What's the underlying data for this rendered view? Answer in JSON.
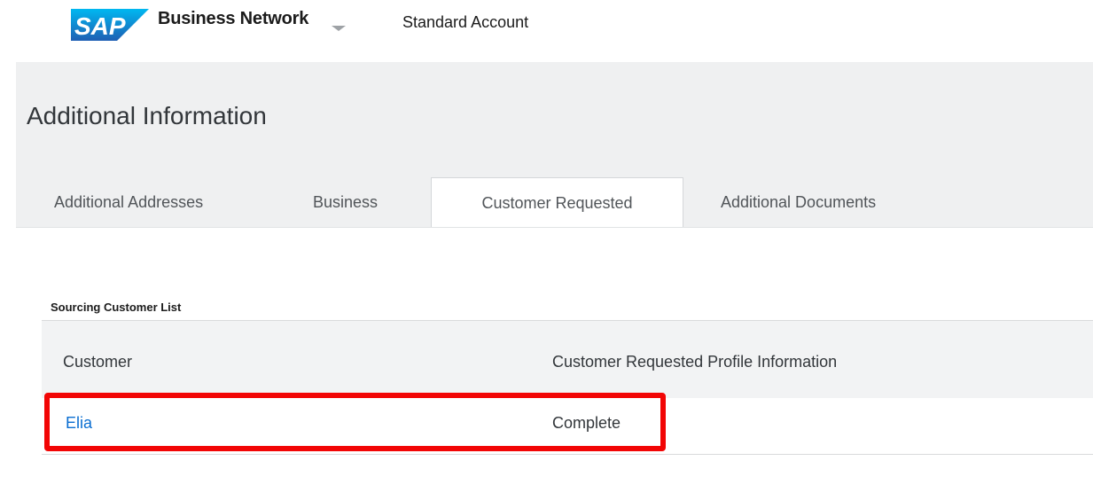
{
  "header": {
    "logo_text": "SAP",
    "product": "Business Network",
    "account_type": "Standard Account"
  },
  "page": {
    "title": "Additional Information"
  },
  "tabs": [
    {
      "label": "Additional Addresses",
      "active": false
    },
    {
      "label": "Business",
      "active": false
    },
    {
      "label": "Customer Requested",
      "active": true
    },
    {
      "label": "Additional Documents",
      "active": false
    }
  ],
  "section": {
    "label": "Sourcing Customer List"
  },
  "table": {
    "columns": [
      "Customer",
      "Customer Requested Profile Information"
    ],
    "rows": [
      {
        "customer": "Elia",
        "status": "Complete"
      }
    ]
  },
  "colors": {
    "sap_blue": "#0a6ed1",
    "logo_gradient_top": "#00b8f1",
    "logo_gradient_bottom": "#1e5fb3",
    "highlight": "#f20505"
  },
  "icons": {
    "logo": "sap-logo",
    "product_menu": "chevron-down-icon"
  }
}
